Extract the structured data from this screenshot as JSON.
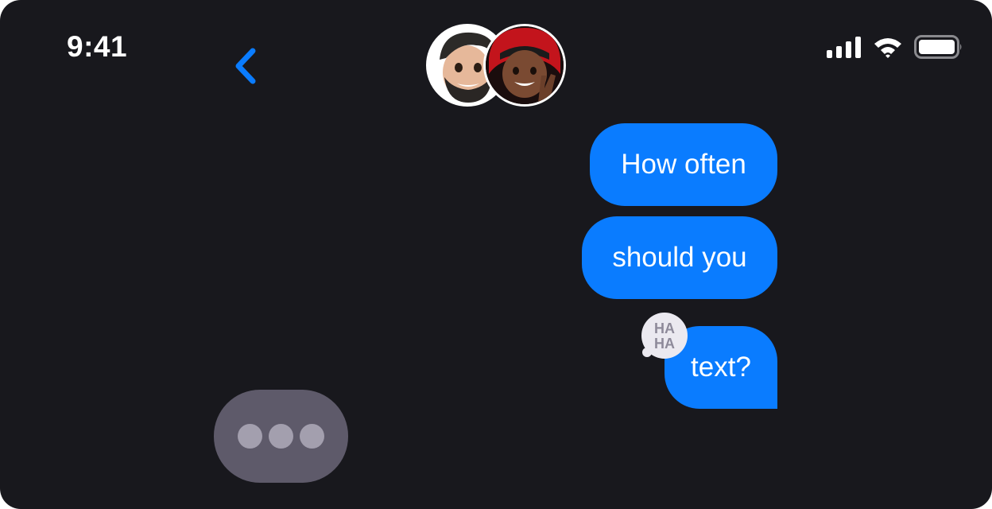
{
  "status_bar": {
    "time": "9:41",
    "icons": [
      "cellular-signal-icon",
      "wifi-icon",
      "battery-icon"
    ]
  },
  "header": {
    "back_icon": "chevron-left-icon",
    "participants": [
      "memoji-man-beard",
      "memoji-woman-red-bonnet"
    ]
  },
  "colors": {
    "background": "#18181d",
    "bubble_sent": "#0a7cff",
    "accent": "#0a7cff",
    "typing_bubble": "#5e5a6a",
    "typing_dot": "#a39fae",
    "tapback_bg": "#ebe9f0",
    "tapback_text": "#8e8a9a"
  },
  "messages": [
    {
      "text": "How often",
      "direction": "sent"
    },
    {
      "text": "should you",
      "direction": "sent"
    },
    {
      "text": "text?",
      "direction": "sent",
      "tapback": {
        "type": "haha",
        "line1": "HA",
        "line2": "HA"
      }
    }
  ],
  "typing_indicator": {
    "visible": true,
    "dots": 3
  }
}
